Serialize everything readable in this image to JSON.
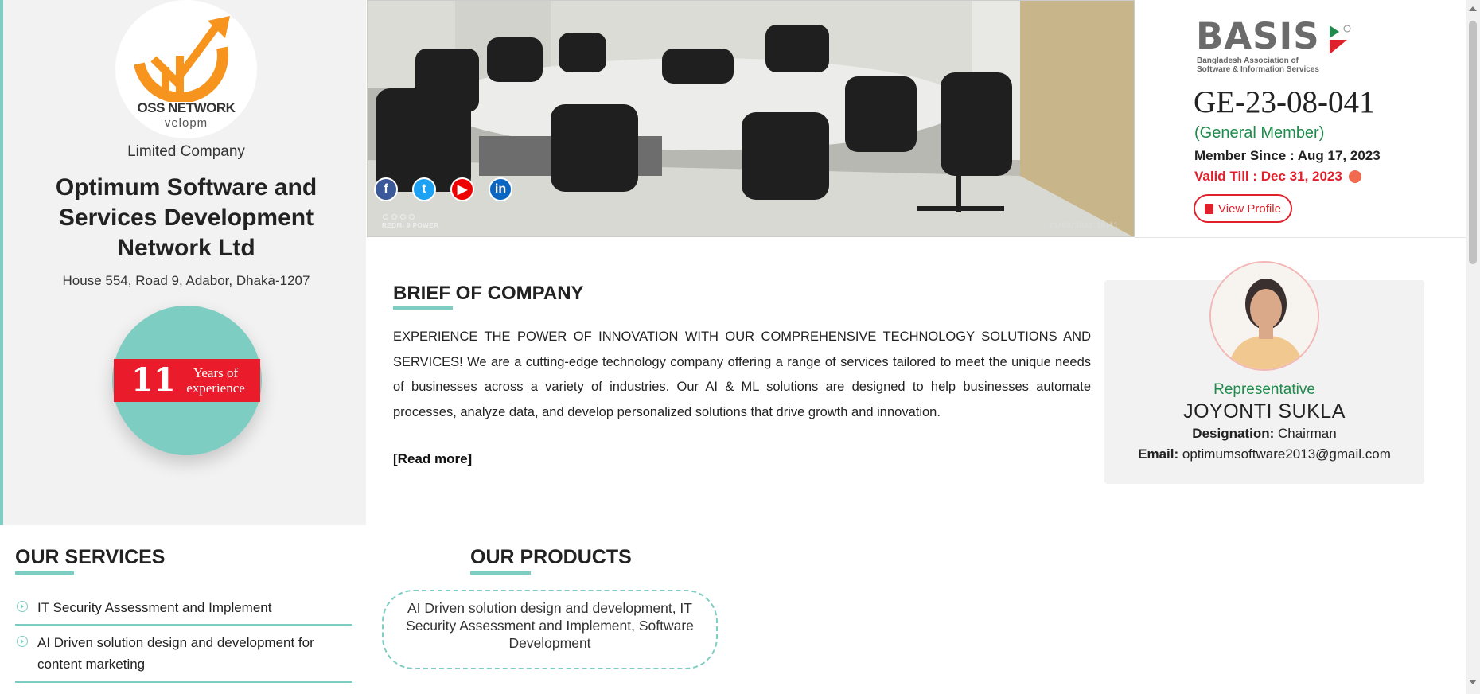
{
  "company": {
    "logo_text_line1": "OSS NETWORK",
    "logo_text_line2": "velopm",
    "type": "Limited Company",
    "name": "Optimum Software and Services Development Network Ltd",
    "address": "House 554, Road 9, Adabor, Dhaka-1207",
    "experience": {
      "years": "11",
      "label": "Years of experience"
    }
  },
  "hero": {
    "device_tag": "REDMI 9 POWER",
    "photo_date": "23/08/2023 18:11",
    "social": [
      {
        "icon": "facebook-icon",
        "glyph": "f"
      },
      {
        "icon": "twitter-icon",
        "glyph": "t"
      },
      {
        "icon": "youtube-icon",
        "glyph": "▶"
      },
      {
        "icon": "linkedin-icon",
        "glyph": "in"
      }
    ]
  },
  "membership": {
    "logo_word": "BASIS",
    "logo_sub_line1": "Bangladesh Association of",
    "logo_sub_line2": "Software & Information Services",
    "registration_no": "GE-23-08-041",
    "member_type": "(General Member)",
    "member_since": "Member Since : Aug 17, 2023",
    "valid_till": "Valid Till : Dec 31, 2023",
    "view_profile_label": "View Profile",
    "colors": {
      "status_red": "#e0202b",
      "member_green": "#1f8a4c",
      "indicator": "#f06a4e"
    }
  },
  "brief": {
    "heading": "BRIEF OF COMPANY",
    "text": "EXPERIENCE THE POWER OF INNOVATION WITH OUR COMPREHENSIVE TECHNOLOGY SOLUTIONS AND SERVICES! We are a cutting-edge technology company offering a range of services tailored to meet the unique needs of businesses across a variety of industries. Our AI & ML solutions are designed to help businesses automate processes, analyze data, and develop personalized solutions that drive growth and innovation.",
    "read_more": "[Read more]"
  },
  "representative": {
    "role": "Representative",
    "name": "JOYONTI SUKLA",
    "designation_label": "Designation:",
    "designation": "Chairman",
    "email_label": "Email:",
    "email": "optimumsoftware2013@gmail.com"
  },
  "services": {
    "heading": "OUR SERVICES",
    "items": [
      "IT Security Assessment and Implement",
      "AI Driven solution design and development for content marketing"
    ]
  },
  "products": {
    "heading": "OUR PRODUCTS",
    "text": "AI Driven solution design and development, IT Security Assessment and Implement, Software Development"
  },
  "theme": {
    "accent": "#7ecdc3",
    "experience_band": "#ea1c2c"
  }
}
